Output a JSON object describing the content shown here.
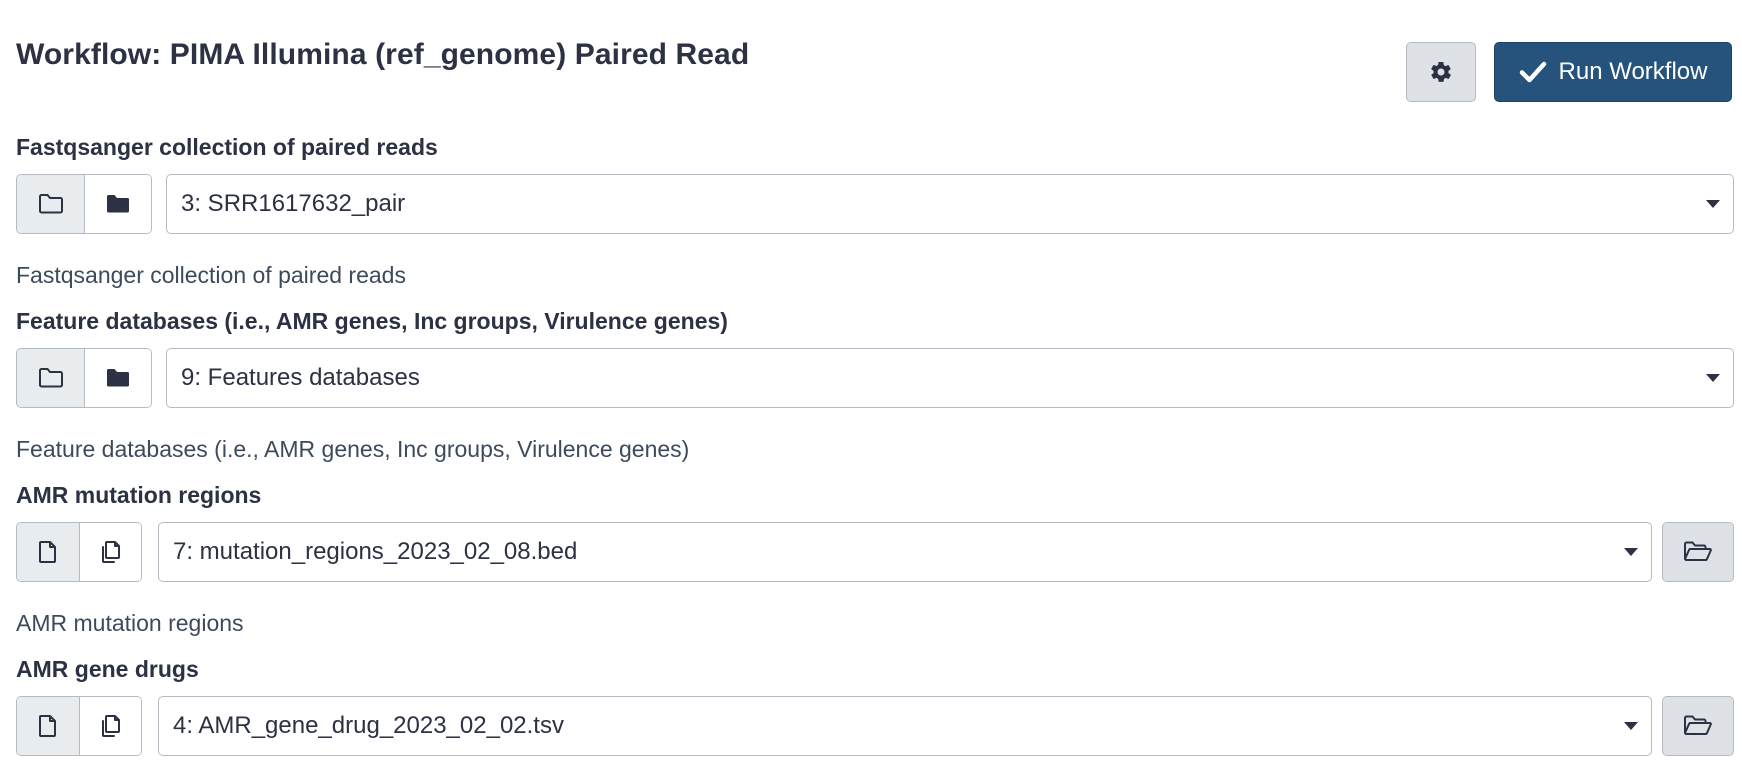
{
  "header": {
    "title": "Workflow: PIMA Illumina (ref_genome) Paired Read",
    "run_label": "Run Workflow",
    "settings_icon": "gear-icon",
    "run_icon": "check-icon"
  },
  "colors": {
    "primary": "#25537b",
    "secondary_bg": "#dee2e6",
    "border": "#b5bbc4",
    "text": "#2c3143"
  },
  "inputs": [
    {
      "label": "Fastqsanger collection of paired reads",
      "value": "3: SRR1617632_pair",
      "help": "Fastqsanger collection of paired reads",
      "buttons": [
        "folder-outline-icon",
        "folder-solid-icon"
      ]
    },
    {
      "label": "Feature databases (i.e., AMR genes, Inc groups, Virulence genes)",
      "value": "9: Features databases",
      "help": "Feature databases (i.e., AMR genes, Inc groups, Virulence genes)",
      "buttons": [
        "folder-outline-icon",
        "folder-solid-icon"
      ]
    },
    {
      "label": "AMR mutation regions",
      "value": "7: mutation_regions_2023_02_08.bed",
      "help": "AMR mutation regions",
      "buttons": [
        "file-icon",
        "files-icon"
      ],
      "browse_icon": "folder-open-icon"
    },
    {
      "label": "AMR gene drugs",
      "value": "4: AMR_gene_drug_2023_02_02.tsv",
      "buttons": [
        "file-icon",
        "files-icon"
      ],
      "browse_icon": "folder-open-icon"
    }
  ]
}
